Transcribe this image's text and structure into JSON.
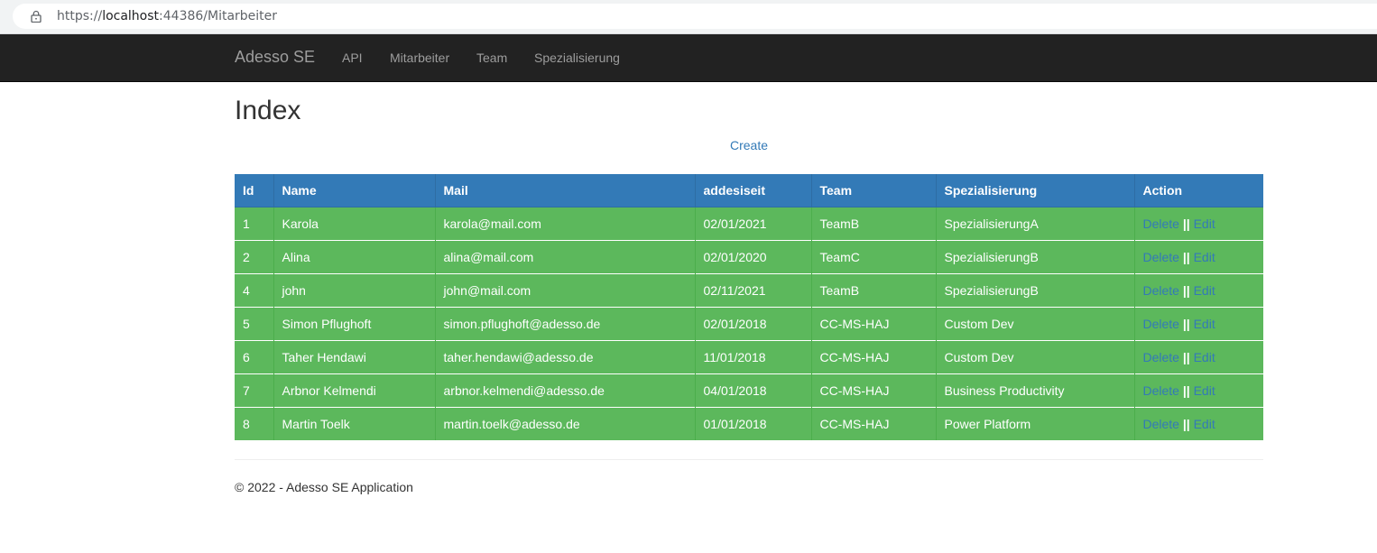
{
  "browser": {
    "url_prefix": "https://",
    "url_host": "localhost",
    "url_rest": ":44386/Mitarbeiter",
    "icon": "lock-icon"
  },
  "navbar": {
    "brand": "Adesso SE",
    "items": [
      {
        "label": "API"
      },
      {
        "label": "Mitarbeiter"
      },
      {
        "label": "Team"
      },
      {
        "label": "Spezialisierung"
      }
    ]
  },
  "page": {
    "title": "Index",
    "create_label": "Create"
  },
  "table": {
    "headers": [
      "Id",
      "Name",
      "Mail",
      "addesiseit",
      "Team",
      "Spezialisierung",
      "Action"
    ],
    "rows": [
      {
        "id": "1",
        "name": "Karola",
        "mail": "karola@mail.com",
        "since": "02/01/2021",
        "team": "TeamB",
        "spec": "SpezialisierungA",
        "delete": "Delete",
        "sep": "||",
        "edit": "Edit"
      },
      {
        "id": "2",
        "name": "Alina",
        "mail": "alina@mail.com",
        "since": "02/01/2020",
        "team": "TeamC",
        "spec": "SpezialisierungB",
        "delete": "Delete",
        "sep": "||",
        "edit": "Edit"
      },
      {
        "id": "4",
        "name": "john",
        "mail": "john@mail.com",
        "since": "02/11/2021",
        "team": "TeamB",
        "spec": "SpezialisierungB",
        "delete": "Delete",
        "sep": "||",
        "edit": "Edit"
      },
      {
        "id": "5",
        "name": "Simon Pflughoft",
        "mail": "simon.pflughoft@adesso.de",
        "since": "02/01/2018",
        "team": "CC-MS-HAJ",
        "spec": "Custom Dev",
        "delete": "Delete",
        "sep": "||",
        "edit": "Edit"
      },
      {
        "id": "6",
        "name": "Taher Hendawi",
        "mail": "taher.hendawi@adesso.de",
        "since": "11/01/2018",
        "team": "CC-MS-HAJ",
        "spec": "Custom Dev",
        "delete": "Delete",
        "sep": "||",
        "edit": "Edit"
      },
      {
        "id": "7",
        "name": "Arbnor Kelmendi",
        "mail": "arbnor.kelmendi@adesso.de",
        "since": "04/01/2018",
        "team": "CC-MS-HAJ",
        "spec": "Business Productivity",
        "delete": "Delete",
        "sep": "||",
        "edit": "Edit"
      },
      {
        "id": "8",
        "name": "Martin Toelk",
        "mail": "martin.toelk@adesso.de",
        "since": "01/01/2018",
        "team": "CC-MS-HAJ",
        "spec": "Power Platform",
        "delete": "Delete",
        "sep": "||",
        "edit": "Edit"
      }
    ]
  },
  "footer": {
    "text": "© 2022 - Adesso SE Application"
  },
  "colors": {
    "navbar_bg": "#222222",
    "header_bg": "#337ab7",
    "row_bg": "#5cb85c",
    "link": "#337ab7"
  }
}
